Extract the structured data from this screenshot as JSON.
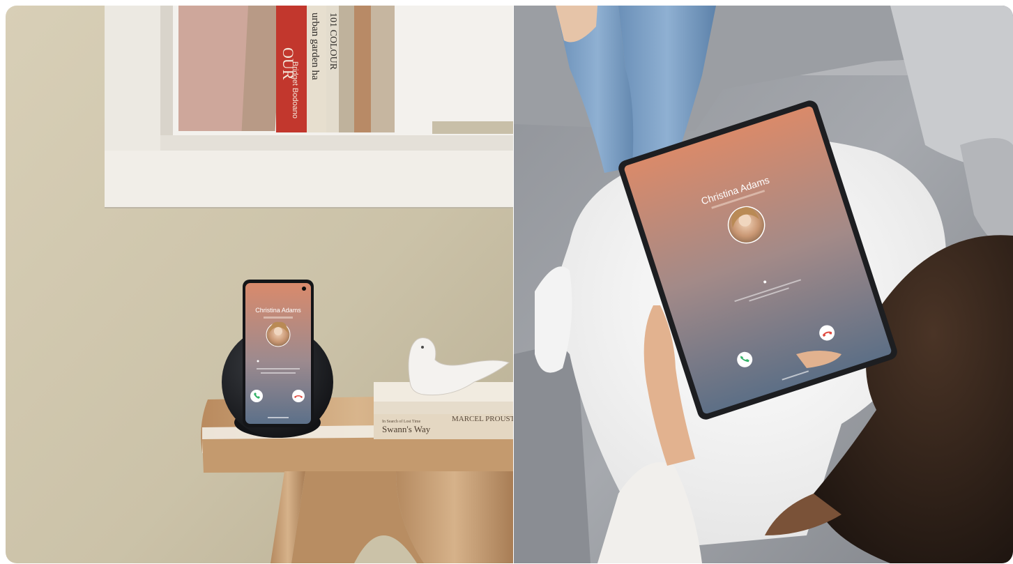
{
  "scene": {
    "left_panel": {
      "device": "smartphone-on-wireless-charger",
      "caller_name": "Christina Adams",
      "book_spines": [
        "OUR",
        "Bridget Bodoano",
        "urban garden ha",
        "101 COLOUR"
      ],
      "book_stack_titles": [
        "MARCEL PROUST",
        "Swann's Way",
        "In Search of Lost Time"
      ]
    },
    "right_panel": {
      "device": "tablet-held-on-couch",
      "caller_name": "Christina Adams"
    },
    "colors": {
      "screen_top": "#d4866a",
      "screen_bottom": "#5b6f86",
      "accept_green": "#36b36a",
      "decline_red": "#e04a3f",
      "wall": "#cfc6ae",
      "couch": "#9da0a6"
    }
  }
}
